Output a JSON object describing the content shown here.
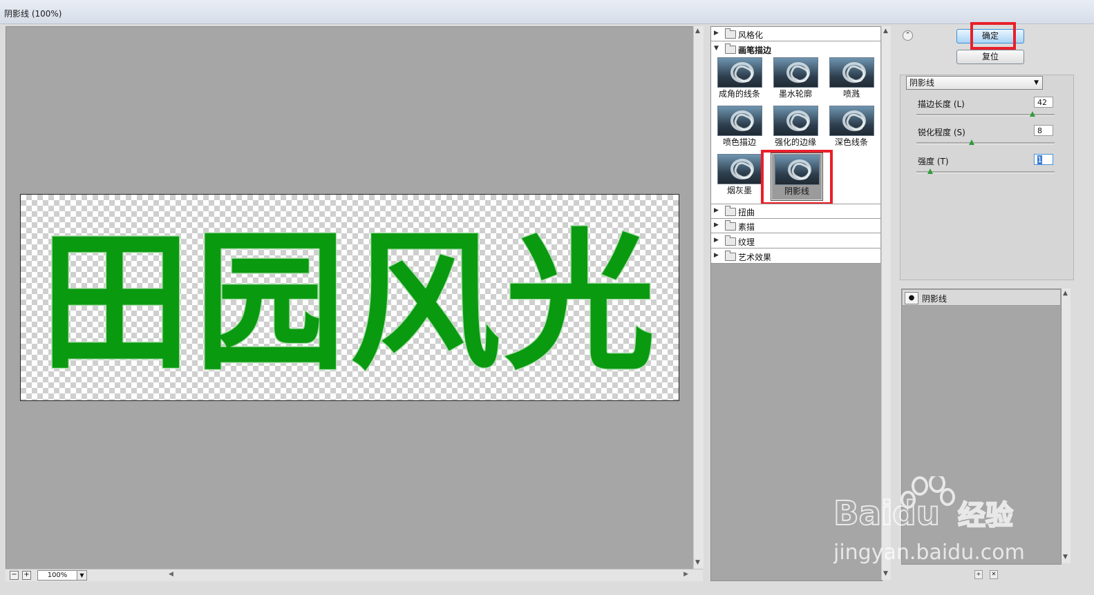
{
  "window": {
    "title": "阴影线 (100%)"
  },
  "preview": {
    "text": "田园风光",
    "text_color": "#0a9a10",
    "zoom": "100%",
    "zoom_out_symbol": "−",
    "zoom_in_symbol": "+"
  },
  "gallery": {
    "categories": [
      {
        "label": "风格化",
        "expanded": false
      },
      {
        "label": "画笔描边",
        "expanded": true
      },
      {
        "label": "扭曲",
        "expanded": false
      },
      {
        "label": "素描",
        "expanded": false
      },
      {
        "label": "纹理",
        "expanded": false
      },
      {
        "label": "艺术效果",
        "expanded": false
      }
    ],
    "filters": [
      {
        "label": "成角的线条"
      },
      {
        "label": "墨水轮廓"
      },
      {
        "label": "喷溅"
      },
      {
        "label": "喷色描边"
      },
      {
        "label": "强化的边缘"
      },
      {
        "label": "深色线条"
      },
      {
        "label": "烟灰墨"
      },
      {
        "label": "阴影线",
        "selected": true
      }
    ]
  },
  "buttons": {
    "ok": "确定",
    "reset": "复位"
  },
  "settings": {
    "filter_select": "阴影线",
    "params": [
      {
        "label": "描边长度 (L)",
        "value": "42",
        "slider_fraction": 0.84
      },
      {
        "label": "锐化程度 (S)",
        "value": "8",
        "slider_fraction": 0.4
      },
      {
        "label": "强度 (T)",
        "value": "1",
        "slider_fraction": 0.1
      }
    ]
  },
  "layers": {
    "items": [
      {
        "label": "阴影线"
      }
    ]
  },
  "watermark": {
    "brand": "Baidu",
    "product": "经验",
    "url": "jingyan.baidu.com"
  },
  "colors": {
    "highlight": "#e8202a",
    "accent_text_green": "#0a9a10",
    "slider_knob": "#2f9c3a"
  }
}
